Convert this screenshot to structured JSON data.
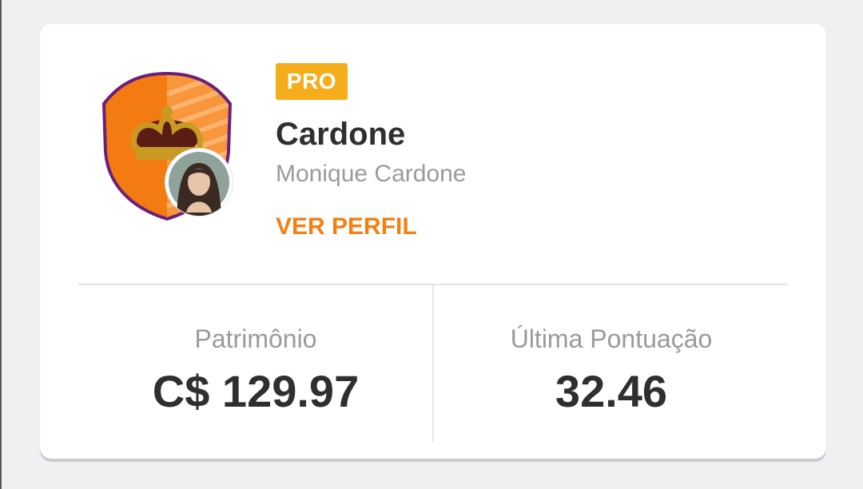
{
  "team": {
    "badge": "PRO",
    "name": "Cardone",
    "owner": "Monique Cardone",
    "profile_link": "VER PERFIL",
    "crest_icon": "shield-crown-icon",
    "avatar_icon": "user-avatar-photo",
    "colors": {
      "accent": "#f47f12",
      "badge": "#f5ad1b",
      "crest_orange": "#f58220",
      "crest_border": "#6b1f7a",
      "crown_gold": "#c99a22"
    }
  },
  "stats": {
    "patrimonio_label": "Patrimônio",
    "patrimonio_value": "C$ 129.97",
    "pontuacao_label": "Última Pontuação",
    "pontuacao_value": "32.46"
  }
}
